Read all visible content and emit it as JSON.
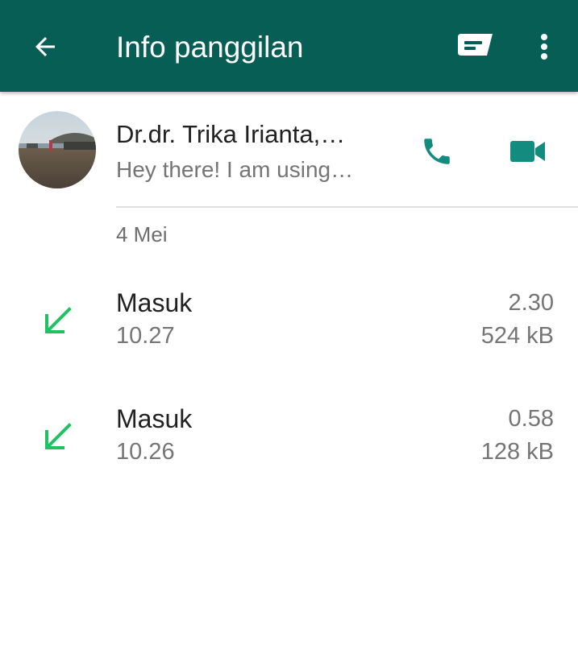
{
  "app_bar": {
    "title": "Info panggilan",
    "icons": {
      "back": "back-arrow-icon",
      "message": "message-icon",
      "more": "more-vert-icon"
    },
    "color": "#075e54"
  },
  "contact": {
    "name": "Dr.dr. Trika Irianta,…",
    "status": "Hey there! I am using…",
    "avatar": "avatar-beach-photo",
    "actions": {
      "call": "phone-icon",
      "video": "videocam-icon"
    },
    "accent_color": "#128c7e"
  },
  "date_header": "4 Mei",
  "calls": [
    {
      "type": "Masuk",
      "time": "10.27",
      "duration": "2.30",
      "size": "524 kB",
      "direction_icon": "incoming-call-arrow-icon"
    },
    {
      "type": "Masuk",
      "time": "10.26",
      "duration": "0.58",
      "size": "128 kB",
      "direction_icon": "incoming-call-arrow-icon"
    }
  ],
  "colors": {
    "incoming_arrow": "#21c063",
    "primary_text": "#212121",
    "secondary_text": "#757575"
  }
}
